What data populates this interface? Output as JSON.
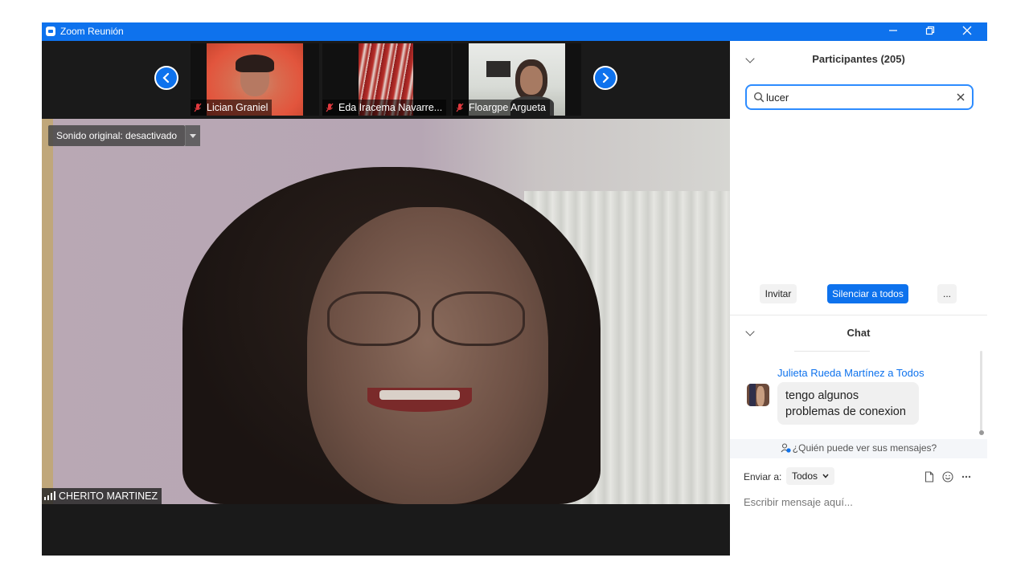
{
  "window": {
    "title": "Zoom Reunión",
    "controls": [
      "minimize",
      "restore",
      "close"
    ]
  },
  "gallery_strip": {
    "participants": [
      {
        "name": "Lician Graniel",
        "muted": true
      },
      {
        "name": "Eda Iracema Navarre...",
        "muted": true
      },
      {
        "name": "Floargpe Argueta",
        "muted": true
      }
    ]
  },
  "main_video": {
    "sound_label": "Sonido original: desactivado",
    "speaker_name": "CHERITO MARTINEZ"
  },
  "participants_panel": {
    "title": "Participantes (205)",
    "search_value": "lucer",
    "buttons": {
      "invite": "Invitar",
      "mute_all": "Silenciar a todos",
      "more": "..."
    }
  },
  "chat": {
    "title": "Chat",
    "messages": [
      {
        "sender": "Julieta Rueda Martínez a Todos",
        "text_line1": "tengo algunos",
        "text_line2": "problemas de conexion"
      }
    ],
    "who_can_see": "¿Quién puede ver sus mensajes?",
    "send_to_label": "Enviar a:",
    "send_to_value": "Todos",
    "compose_placeholder": "Escribir mensaje aquí..."
  },
  "colors": {
    "accent": "#0e72ed",
    "titlebar": "#0e72ed",
    "video_bg": "#1a1a1a",
    "muted_icon": "#e0393e"
  },
  "icons": [
    "zoom-app-icon",
    "minimize-icon",
    "restore-icon",
    "close-icon",
    "chevron-left-icon",
    "chevron-right-icon",
    "muted-mic-icon",
    "signal-bars-icon",
    "collapse-chevron-icon",
    "search-icon",
    "clear-icon",
    "privacy-icon",
    "file-icon",
    "emoji-icon",
    "more-icon"
  ]
}
